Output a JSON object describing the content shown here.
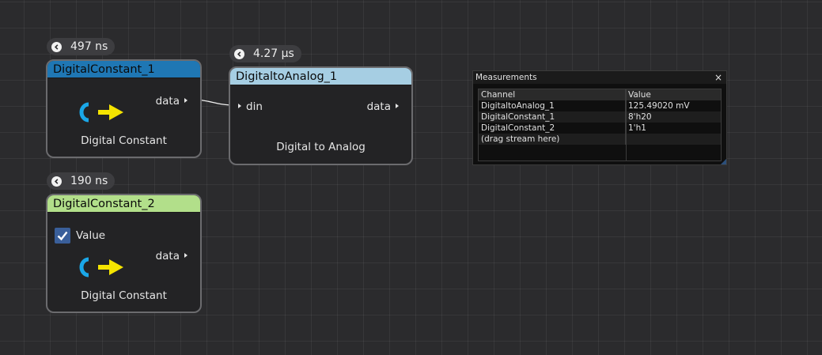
{
  "nodes": {
    "dc1": {
      "timer": "497 ns",
      "title": "DigitalConstant_1",
      "header_color": "#1f77b4",
      "output_pin": "data",
      "label": "Digital Constant",
      "icon": "constant-arrow-icon"
    },
    "dta1": {
      "timer": "4.27 µs",
      "title": "DigitaltoAnalog_1",
      "header_color": "#a6cee3",
      "input_pin": "din",
      "output_pin": "data",
      "label": "Digital to Analog"
    },
    "dc2": {
      "timer": "190 ns",
      "title": "DigitalConstant_2",
      "header_color": "#b2df8a",
      "checkbox_label": "Value",
      "checkbox_checked": true,
      "output_pin": "data",
      "label": "Digital Constant",
      "icon": "constant-arrow-icon"
    }
  },
  "measurements": {
    "title": "Measurements",
    "close": "×",
    "columns": [
      "Channel",
      "Value"
    ],
    "rows": [
      {
        "channel": "DigitaltoAnalog_1",
        "value": "125.49020 mV"
      },
      {
        "channel": "DigitalConstant_1",
        "value": "8'h20"
      },
      {
        "channel": "DigitalConstant_2",
        "value": "1'h1"
      },
      {
        "channel": "(drag stream here)",
        "value": ""
      }
    ]
  },
  "colors": {
    "icon_c": "#1aa7e8",
    "icon_arrow": "#f5e400",
    "checkbox": "#3a5f9a"
  }
}
